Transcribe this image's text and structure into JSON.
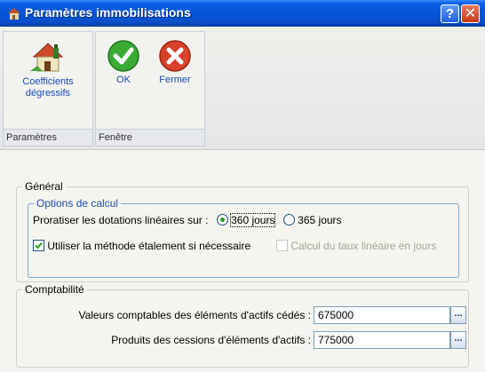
{
  "window": {
    "title": "Paramètres immobilisations",
    "help_button": "?",
    "close_button": "✕"
  },
  "ribbon": {
    "coefficients_label": "Coefficients dégressifs",
    "params_group_label": "Paramètres",
    "ok_label": "OK",
    "fermer_label": "Fermer",
    "window_group_label": "Fenêtre"
  },
  "general": {
    "legend": "Général",
    "options": {
      "legend": "Options de calcul",
      "proratiser_label": "Proratiser les dotations linéaires sur :",
      "radio_360_label": "360 jours",
      "radio_365_label": "365 jours",
      "selected_radio": "360 jours",
      "etalement_label": "Utiliser la méthode étalement si nécessaire",
      "etalement_checked": true,
      "calcul_taux_label": "Calcul du taux linéaire en jours",
      "calcul_taux_checked": false,
      "calcul_taux_enabled": false
    }
  },
  "comptabilite": {
    "legend": "Comptabilité",
    "valeurs_label": "Valeurs comptables des éléments d'actifs cédés :",
    "valeurs_value": "675000",
    "produits_label": "Produits des cessions d'éléments d'actifs :",
    "produits_value": "775000",
    "browse_label": "..."
  },
  "colors": {
    "titlebar": "#0654d8",
    "ok_green": "#3aaa35",
    "close_red": "#d9412a",
    "link_blue": "#1a4bb8"
  },
  "icons": {
    "app": "house-icon",
    "coefficients": "house-chart-icon",
    "ok": "checkmark-icon",
    "fermer": "cross-icon"
  }
}
